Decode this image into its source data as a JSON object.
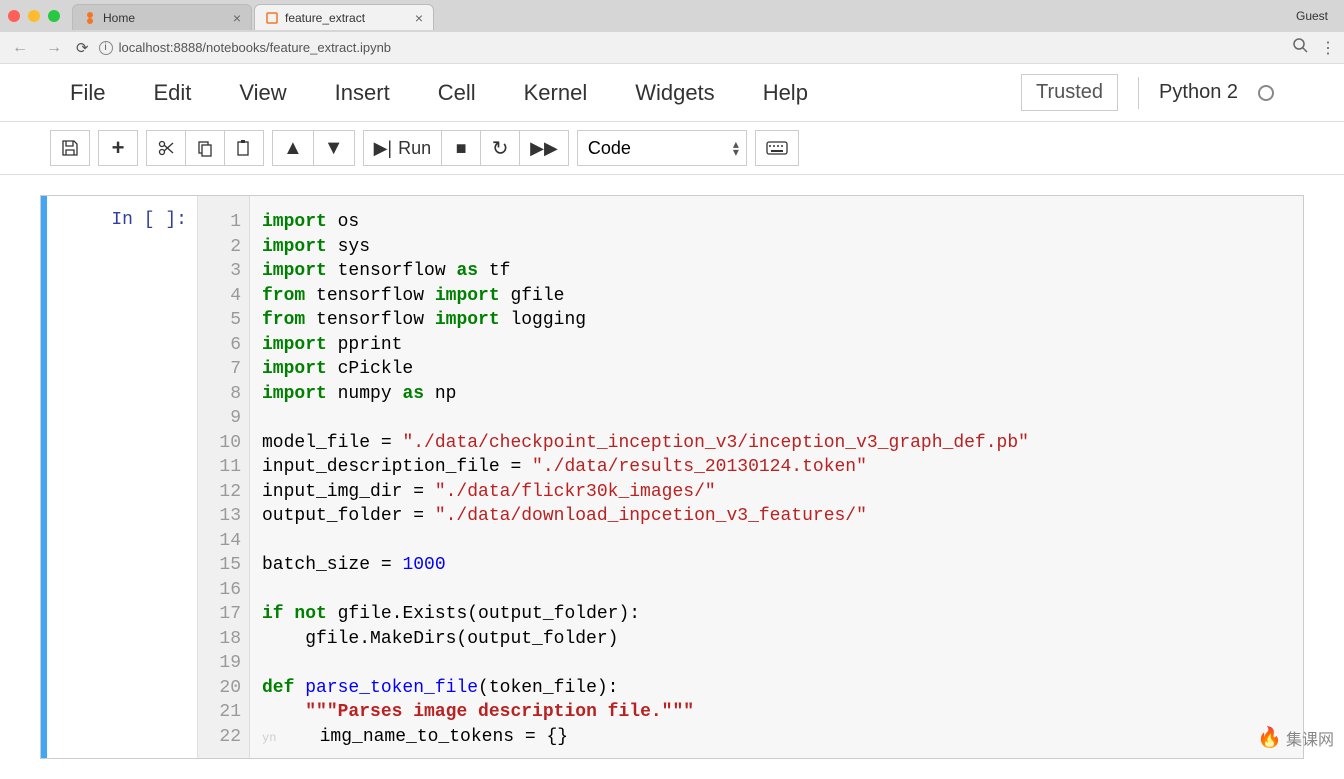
{
  "browser": {
    "tabs": [
      {
        "title": "Home",
        "icon": "jupyter"
      },
      {
        "title": "feature_extract",
        "icon": "notebook"
      }
    ],
    "guest_label": "Guest",
    "url": "localhost:8888/notebooks/feature_extract.ipynb"
  },
  "menubar": {
    "items": [
      "File",
      "Edit",
      "View",
      "Insert",
      "Cell",
      "Kernel",
      "Widgets",
      "Help"
    ],
    "trusted": "Trusted",
    "kernel": "Python 2"
  },
  "toolbar": {
    "run_label": "Run",
    "celltype": "Code"
  },
  "cell": {
    "prompt": "In [ ]:",
    "line_count": 22,
    "code_tokens": [
      [
        {
          "c": "k",
          "t": "import"
        },
        {
          "c": "",
          "t": " os"
        }
      ],
      [
        {
          "c": "k",
          "t": "import"
        },
        {
          "c": "",
          "t": " sys"
        }
      ],
      [
        {
          "c": "k",
          "t": "import"
        },
        {
          "c": "",
          "t": " tensorflow "
        },
        {
          "c": "k",
          "t": "as"
        },
        {
          "c": "",
          "t": " tf"
        }
      ],
      [
        {
          "c": "k",
          "t": "from"
        },
        {
          "c": "",
          "t": " tensorflow "
        },
        {
          "c": "k",
          "t": "import"
        },
        {
          "c": "",
          "t": " gfile"
        }
      ],
      [
        {
          "c": "k",
          "t": "from"
        },
        {
          "c": "",
          "t": " tensorflow "
        },
        {
          "c": "k",
          "t": "import"
        },
        {
          "c": "",
          "t": " logging"
        }
      ],
      [
        {
          "c": "k",
          "t": "import"
        },
        {
          "c": "",
          "t": " pprint"
        }
      ],
      [
        {
          "c": "k",
          "t": "import"
        },
        {
          "c": "",
          "t": " cPickle"
        }
      ],
      [
        {
          "c": "k",
          "t": "import"
        },
        {
          "c": "",
          "t": " numpy "
        },
        {
          "c": "k",
          "t": "as"
        },
        {
          "c": "",
          "t": " np"
        }
      ],
      [],
      [
        {
          "c": "",
          "t": "model_file = "
        },
        {
          "c": "s",
          "t": "\"./data/checkpoint_inception_v3/inception_v3_graph_def.pb\""
        }
      ],
      [
        {
          "c": "",
          "t": "input_description_file = "
        },
        {
          "c": "s",
          "t": "\"./data/results_20130124.token\""
        }
      ],
      [
        {
          "c": "",
          "t": "input_img_dir = "
        },
        {
          "c": "s",
          "t": "\"./data/flickr30k_images/\""
        }
      ],
      [
        {
          "c": "",
          "t": "output_folder = "
        },
        {
          "c": "s",
          "t": "\"./data/download_inpcetion_v3_features/\""
        }
      ],
      [],
      [
        {
          "c": "",
          "t": "batch_size = "
        },
        {
          "c": "n",
          "t": "1000"
        }
      ],
      [],
      [
        {
          "c": "k",
          "t": "if"
        },
        {
          "c": "",
          "t": " "
        },
        {
          "c": "k",
          "t": "not"
        },
        {
          "c": "",
          "t": " gfile.Exists(output_folder):"
        }
      ],
      [
        {
          "c": "",
          "t": "    gfile.MakeDirs(output_folder)"
        }
      ],
      [],
      [
        {
          "c": "k",
          "t": "def"
        },
        {
          "c": "",
          "t": " "
        },
        {
          "c": "fn",
          "t": "parse_token_file"
        },
        {
          "c": "",
          "t": "(token_file):"
        }
      ],
      [
        {
          "c": "",
          "t": "    "
        },
        {
          "c": "c",
          "t": "\"\"\"Parses image description file.\"\"\""
        }
      ],
      [
        {
          "c": "ghost",
          "t": "yn"
        },
        {
          "c": "",
          "t": "    img_name_to_tokens = {}"
        }
      ]
    ]
  },
  "watermark": "集课网"
}
